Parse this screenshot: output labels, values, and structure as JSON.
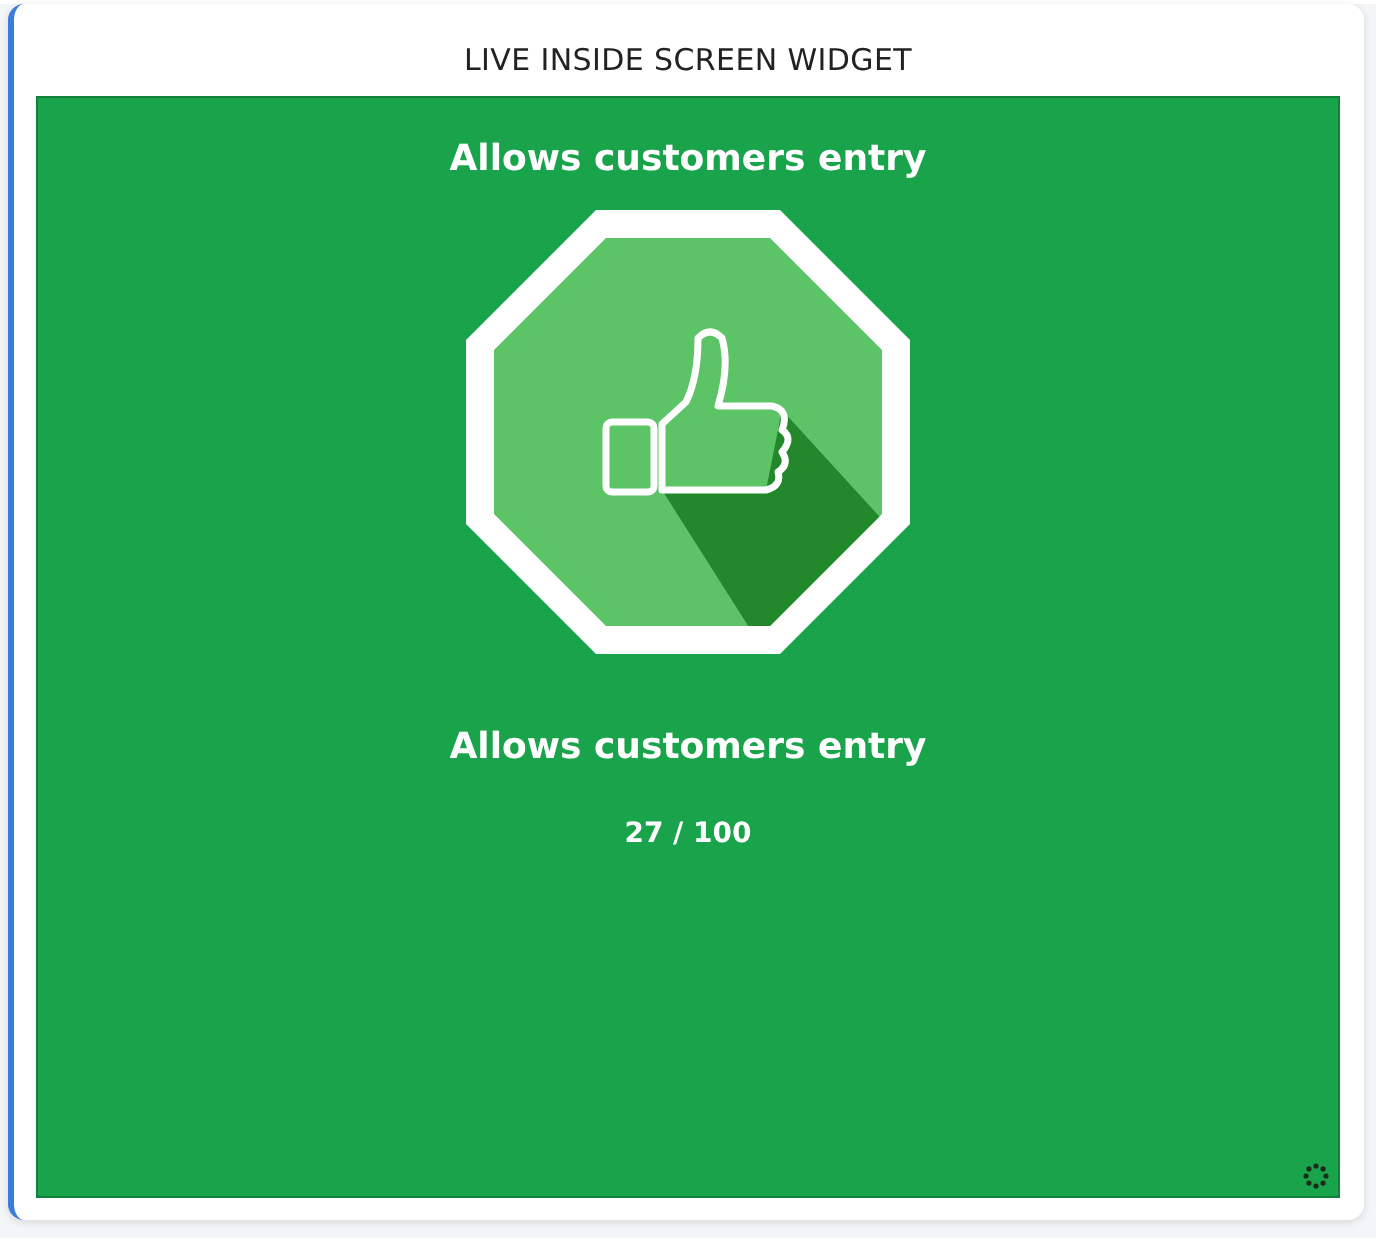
{
  "widget": {
    "title": "LIVE INSIDE SCREEN WIDGET"
  },
  "screen": {
    "heading": "Allows customers entry",
    "status": "Allows customers entry",
    "count": "27 / 100"
  }
}
